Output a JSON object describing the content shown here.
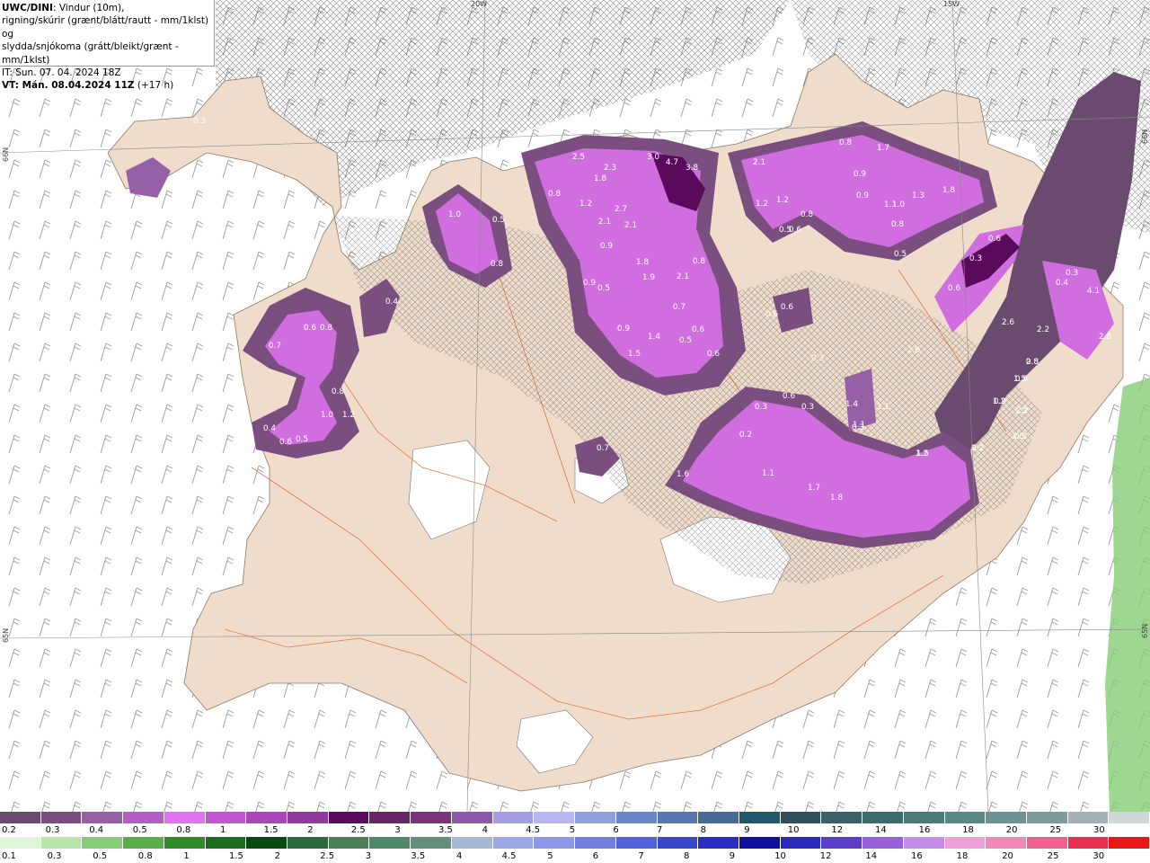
{
  "info": {
    "line1_bold": "UWC/DINI",
    "line1_rest": ": Vindur (10m),",
    "line2": "rigning/skúrir (grænt/blátt/rautt - mm/1klst) og",
    "line3": "slydda/snjókoma (grátt/bleikt/grænt - mm/1klst)",
    "line4": "IT: Sun. 07. 04. 2024 18Z",
    "line5_bold": "VT: Mán. 08.04.2024 11Z",
    "line5_rest": " (+17 h)"
  },
  "grid_labels": {
    "lon_20w": "20W",
    "lon_15w": "15W",
    "lat_left_66": "66N",
    "lat_right_66": "66N",
    "lat_left_65": "65N",
    "lat_right_65": "65N"
  },
  "map_labels": [
    "0.3",
    "0.3",
    "0.3",
    "1.0",
    "2.5",
    "2.3",
    "1.8",
    "3.0",
    "4.7",
    "3.8",
    "2.1",
    "0.8",
    "1.7",
    "0.9",
    "0.9",
    "1.3",
    "1.8",
    "1.0",
    "0.5",
    "0.8",
    "1.2",
    "2.7",
    "2.1",
    "2.1",
    "1.2",
    "1.2",
    "0.8",
    "0.5",
    "0.8",
    "1.1",
    "0.8",
    "0.5",
    "0.6",
    "0.6",
    "0.6",
    "0.3",
    "0.9",
    "1.8",
    "1.9",
    "2.1",
    "0.5",
    "0.9",
    "0.7",
    "0.9",
    "1.4",
    "1.5",
    "0.5",
    "0.6",
    "0.6",
    "0.8",
    "0.6",
    "0.3",
    "0.6",
    "0.3",
    "0.4",
    "4.1",
    "2.6",
    "2.2",
    "2.8",
    "2.6",
    "2.8",
    "1.5",
    "0.9",
    "2.2",
    "1.0",
    "1.2",
    "1.2",
    "0.7",
    "0.8",
    "1.0",
    "1.2",
    "0.4",
    "0.6",
    "0.5",
    "0.7",
    "0.6",
    "0.8",
    "0.4",
    "0.6",
    "0.3",
    "0.3",
    "0.2",
    "1.4",
    "1.1",
    "1.1",
    "0.8",
    "0.5",
    "1.2",
    "1.2",
    "0.3",
    "0.7",
    "1.5",
    "1.6",
    "1.1",
    "1.7",
    "1.8"
  ],
  "legend": {
    "snow_colors": [
      "#6a4a6e",
      "#7a4f80",
      "#9660a6",
      "#b25ec4",
      "#e173f0",
      "#c157d0",
      "#aa47b8",
      "#903a9e",
      "#5a0a5a",
      "#672668",
      "#7a337c",
      "#8b59a8",
      "#a49fe0",
      "#b9b7f3",
      "#8ea2da",
      "#6b86c8",
      "#5877b0",
      "#476a98",
      "#21576a",
      "#2f4f5b",
      "#3a6168",
      "#3a6c6d",
      "#4b7a7b",
      "#5a8888",
      "#6c9293",
      "#7b9b9c",
      "#a3b1b4",
      "#d0d7d8"
    ],
    "snow_labels": [
      "0.2",
      "0.3",
      "0.4",
      "0.5",
      "0.8",
      "1",
      "1.5",
      "2",
      "2.5",
      "3",
      "3.5",
      "4",
      "4.5",
      "5",
      "6",
      "7",
      "8",
      "9",
      "10",
      "12",
      "14",
      "16",
      "18",
      "20",
      "25",
      "30"
    ],
    "rain_colors": [
      "#ddf7d8",
      "#b4e6a8",
      "#86cd77",
      "#5aae4a",
      "#2f8a2a",
      "#1b6b1f",
      "#0a4a10",
      "#2a6a3c",
      "#4a7e56",
      "#4f8a68",
      "#618f7a",
      "#a5b8d8",
      "#9aa9e6",
      "#8d97e8",
      "#737fe0",
      "#5360d8",
      "#3a48c8",
      "#2a2ec0",
      "#10109e",
      "#2a2ab8",
      "#5b3ec8",
      "#9a5ed8",
      "#c68ee8",
      "#f09ed8",
      "#f088b8",
      "#f06090",
      "#e83050",
      "#e81818"
    ],
    "rain_labels": [
      "0.1",
      "0.3",
      "0.5",
      "0.8",
      "1",
      "1.5",
      "2",
      "2.5",
      "3",
      "3.5",
      "4",
      "4.5",
      "5",
      "6",
      "7",
      "8",
      "9",
      "10",
      "12",
      "14",
      "16",
      "18",
      "20",
      "25",
      "30"
    ]
  }
}
